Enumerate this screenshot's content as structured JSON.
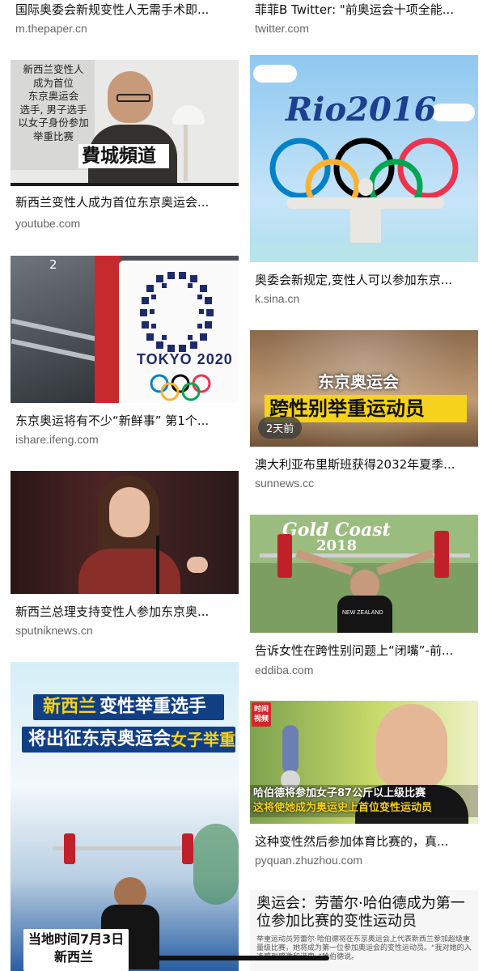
{
  "results": {
    "left": [
      {
        "title": "国际奥委会新规变性人无需手术即...",
        "source": "m.thepaper.cn"
      },
      {
        "title": "新西兰变性人成为首位东京奥运会...",
        "source": "youtube.com",
        "overlay_lines": [
          "新西兰变性人",
          "成为首位",
          "东京奥运会",
          "选手, 男子选手",
          "以女子身份参加",
          "举重比赛"
        ],
        "banner": "費城頻道"
      },
      {
        "title": "东京奥运将有不少“新鲜事” 第1个...",
        "source": "ishare.ifeng.com",
        "platform_number": "2",
        "sign_text": "TOKYO 2020"
      },
      {
        "title": "新西兰总理支持变性人参加东京奥...",
        "source": "sputniknews.cn"
      },
      {
        "title": "",
        "source": "",
        "caption_a": "新西兰",
        "caption_b": "变性举重选手",
        "caption_c": "将出征东京奥运会",
        "caption_d": "女子举重",
        "date_caption": "当地时间7月3日",
        "place_caption": "新西兰"
      }
    ],
    "right": [
      {
        "title": "菲菲B Twitter: \"前奥运会十项全能...",
        "source": "twitter.com"
      },
      {
        "title": "奥委会新规定,变性人可以参加东京...",
        "source": "k.sina.cn",
        "logo_text": "Rio2016"
      },
      {
        "title": "澳大利亚布里斯班获得2032年夏季...",
        "source": "sunnews.cc",
        "caption_top": "东京奥运会",
        "caption_bottom": "跨性别举重运动员",
        "time_badge": "2天前"
      },
      {
        "title": "告诉女性在跨性别问题上“闭嘴”-前...",
        "source": "eddiba.com",
        "event_text": "Gold Coast",
        "event_year": "2018",
        "jersey_text": "NEW ZEALAND"
      },
      {
        "title": "这种变性然后参加体育比赛的，真...",
        "source": "pyquan.zhuzhou.com",
        "badge": "时间视频",
        "line1": "哈伯德将参加女子87公斤以上级比赛",
        "line2": "这将使她成为奥运史上首位变性运动员"
      },
      {
        "title": "",
        "source": "",
        "headline": "奥运会：劳蕾尔·哈伯德成为第一位参加比赛的变性运动员",
        "body": "举重运动员劳蕾尔·哈伯德将在东京奥运会上代表新西兰参加超级重量级比赛，她将成为第一位参加奥运会的变性运动员。“我对她的入选感到感激和谦卑，”哈伯德说。"
      }
    ]
  },
  "colors": {
    "ring_blue": "#0081c8",
    "ring_yellow": "#fcb131",
    "ring_black": "#000000",
    "ring_green": "#00a651",
    "ring_red": "#ee334e",
    "caption_yellow": "#f7d21a"
  }
}
